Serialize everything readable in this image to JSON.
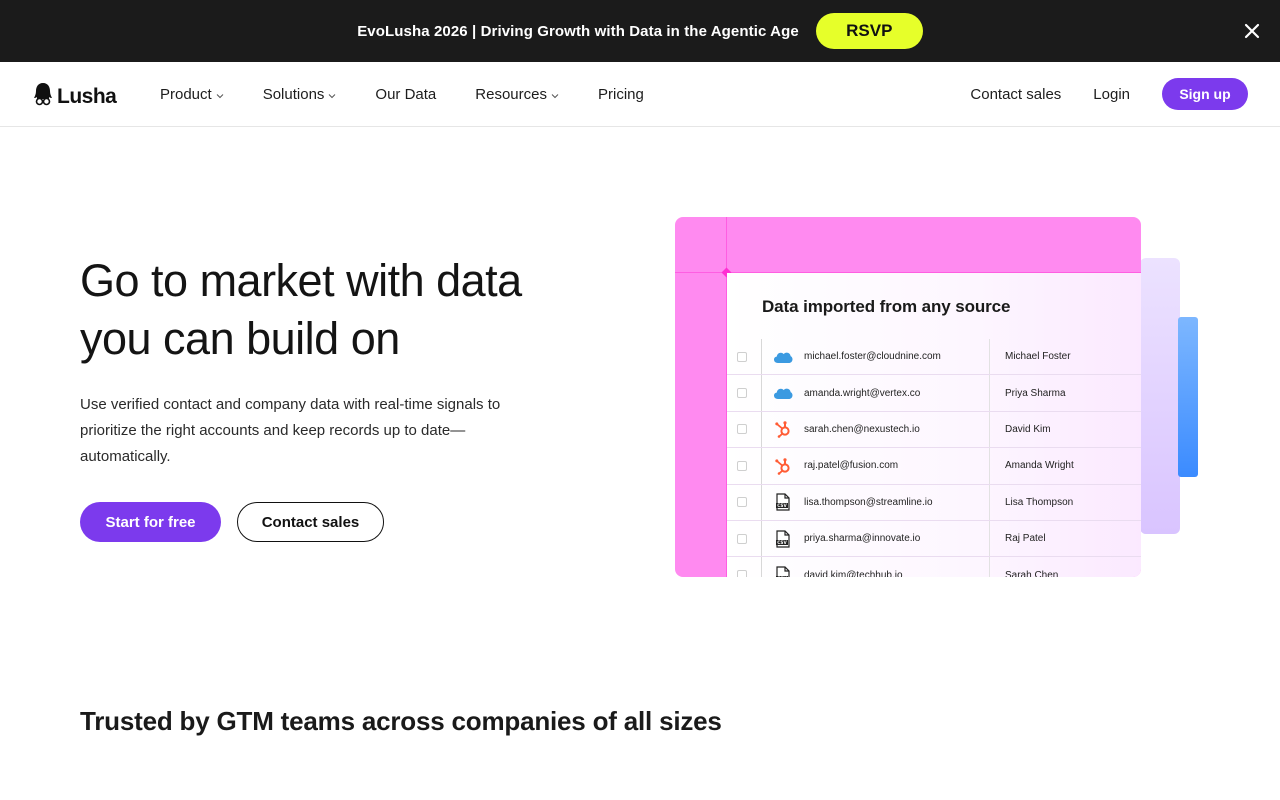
{
  "announcement": {
    "event": "EvoLusha 2026",
    "divider": " | ",
    "tagline": "Driving Growth with Data in the Agentic Age",
    "cta": "RSVP"
  },
  "nav": {
    "logo": "Lusha",
    "items": [
      {
        "label": "Product",
        "dropdown": true
      },
      {
        "label": "Solutions",
        "dropdown": true
      },
      {
        "label": "Our Data",
        "dropdown": false
      },
      {
        "label": "Resources",
        "dropdown": true
      },
      {
        "label": "Pricing",
        "dropdown": false
      }
    ],
    "contact_sales": "Contact sales",
    "login": "Login",
    "signup": "Sign up"
  },
  "hero": {
    "title_line1": "Go to market with data",
    "title_line2": "you can build on",
    "subtitle": "Use verified contact and company data with real-time signals to prioritize the right accounts and keep records up to date—automatically.",
    "primary_cta": "Start for free",
    "secondary_cta": "Contact sales"
  },
  "illustration": {
    "title": "Data imported from any source",
    "rows": [
      {
        "source": "salesforce-icon",
        "email": "michael.foster@cloudnine.com",
        "name": "Michael Foster"
      },
      {
        "source": "salesforce-icon",
        "email": "amanda.wright@vertex.co",
        "name": "Priya Sharma"
      },
      {
        "source": "hubspot-icon",
        "email": "sarah.chen@nexustech.io",
        "name": "David Kim"
      },
      {
        "source": "hubspot-icon",
        "email": "raj.patel@fusion.com",
        "name": "Amanda Wright"
      },
      {
        "source": "csv-file-icon",
        "email": "lisa.thompson@streamline.io",
        "name": "Lisa Thompson"
      },
      {
        "source": "csv-file-icon",
        "email": "priya.sharma@innovate.io",
        "name": "Raj Patel"
      },
      {
        "source": "csv-file-icon",
        "email": "david.kim@techhub.io",
        "name": "Sarah Chen"
      }
    ]
  },
  "trusted": {
    "heading": "Trusted by GTM teams across companies of all sizes"
  },
  "colors": {
    "accent": "#7c3aed",
    "rsvp": "#e6ff2a",
    "announcement_bg": "#1b1b1b",
    "frame_pink": "#ff8af0"
  }
}
